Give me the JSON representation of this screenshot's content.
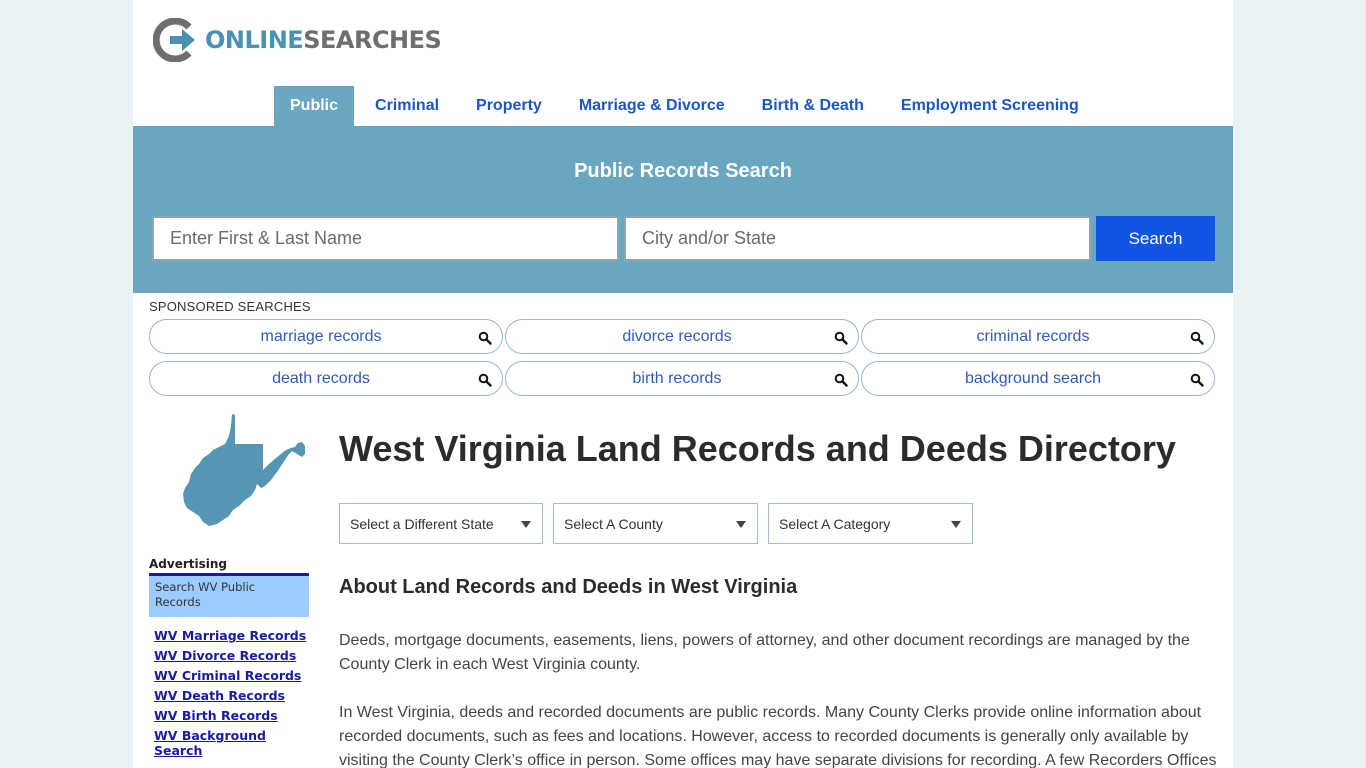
{
  "header": {
    "logo": {
      "word1": "ONLINE",
      "word2": "SEARCHES"
    }
  },
  "nav": {
    "items": [
      {
        "label": "Public",
        "active": true
      },
      {
        "label": "Criminal",
        "active": false
      },
      {
        "label": "Property",
        "active": false
      },
      {
        "label": "Marriage & Divorce",
        "active": false
      },
      {
        "label": "Birth & Death",
        "active": false
      },
      {
        "label": "Employment Screening",
        "active": false
      }
    ]
  },
  "search": {
    "title": "Public Records Search",
    "name_placeholder": "Enter First & Last Name",
    "name_value": "",
    "location_placeholder": "City and/or State",
    "location_value": "",
    "button_label": "Search"
  },
  "sponsored": {
    "label": "SPONSORED SEARCHES",
    "items": [
      {
        "label": "marriage records",
        "icon": "search-icon"
      },
      {
        "label": "divorce records",
        "icon": "search-icon"
      },
      {
        "label": "criminal records",
        "icon": "search-icon"
      },
      {
        "label": "death records",
        "icon": "search-icon"
      },
      {
        "label": "birth records",
        "icon": "search-icon"
      },
      {
        "label": "background search",
        "icon": "search-icon"
      }
    ]
  },
  "sidebar": {
    "map_icon": "west-virginia-map-icon",
    "ad_title": "Advertising",
    "ad_box": "Search WV Public Records",
    "links": [
      "WV Marriage Records",
      "WV Divorce Records",
      "WV Criminal Records",
      "WV Death Records",
      "WV Birth Records",
      "WV Background Search"
    ]
  },
  "main": {
    "title": "West Virginia Land Records and Deeds Directory",
    "selects": {
      "state": "Select a Different State",
      "county": "Select A County",
      "category": "Select A Category"
    },
    "section_heading": "About Land Records and Deeds in West Virginia",
    "paragraphs": [
      "Deeds, mortgage documents, easements, liens, powers of attorney, and other document recordings are managed by the County Clerk in each West Virginia county.",
      "In West Virginia, deeds and recorded documents are public records. Many County Clerks provide online information about recorded documents, such as fees and locations. However, access to recorded documents is generally only available by visiting the County Clerk’s office in person. Some offices may have separate divisions for recording. A few Recorders Offices"
    ]
  },
  "colors": {
    "accent": "#6aa6c0",
    "nav_link": "#1b56c9",
    "search_button": "#1254e3",
    "logo_blue": "#4b91b1",
    "logo_gray": "#6d6e70",
    "ad_box": "#9ccbff",
    "map_fill": "#5596b4",
    "page_bg": "#eaf2f6"
  }
}
